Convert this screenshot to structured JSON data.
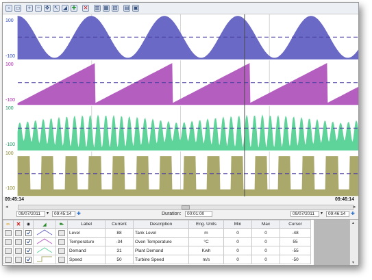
{
  "toolbar": {
    "icons": [
      "new-icon",
      "open-icon",
      "zoom-in-icon",
      "zoom-out-icon",
      "pan-icon",
      "cursor-icon",
      "chart-icon",
      "add-icon",
      "delete-icon",
      "layout-1-icon",
      "layout-2-icon",
      "layout-3-icon",
      "print-icon",
      "export-icon"
    ]
  },
  "traces": [
    {
      "name": "Level",
      "top": "100",
      "bottom": "-100",
      "color": "#6a6ac6",
      "top_color": "#2f48c8"
    },
    {
      "name": "Temperature",
      "top": "100",
      "bottom": "-100",
      "color": "#b45fc0",
      "top_color": "#b41fb4"
    },
    {
      "name": "Demand",
      "top": "100",
      "bottom": "-100",
      "color": "#5ed39a",
      "top_color": "#149a60"
    },
    {
      "name": "Speed",
      "top": "100",
      "bottom": "-100",
      "color": "#aaa86a",
      "top_color": "#8b8a30"
    }
  ],
  "time_axis": {
    "start": "09:45:14",
    "end": "09:46:14"
  },
  "navigation": {
    "start_date": "09/07/2011",
    "start_time": "09:45:14",
    "duration_label": "Duration:",
    "duration_value": "00:01:00",
    "end_date": "09/07/2011",
    "end_time": "09:46:14"
  },
  "table": {
    "headers": [
      "Label",
      "Current",
      "Description",
      "Eng. Units",
      "Min",
      "Max",
      "Cursor"
    ],
    "rows": [
      {
        "label": "Level",
        "current": "88",
        "description": "Tank Level",
        "units": "m",
        "min": "0",
        "max": "0",
        "cursor": "-48",
        "color": "#6a6ac6"
      },
      {
        "label": "Temperature",
        "current": "-34",
        "description": "Oven Temperature",
        "units": "°C",
        "min": "0",
        "max": "0",
        "cursor": "55",
        "color": "#b45fc0"
      },
      {
        "label": "Demand",
        "current": "31",
        "description": "Plant Demand",
        "units": "Kwh",
        "min": "0",
        "max": "0",
        "cursor": "-55",
        "color": "#5ed39a"
      },
      {
        "label": "Speed",
        "current": "50",
        "description": "Turbine Speed",
        "units": "m/s",
        "min": "0",
        "max": "0",
        "cursor": "-50",
        "color": "#aaa86a"
      }
    ]
  }
}
